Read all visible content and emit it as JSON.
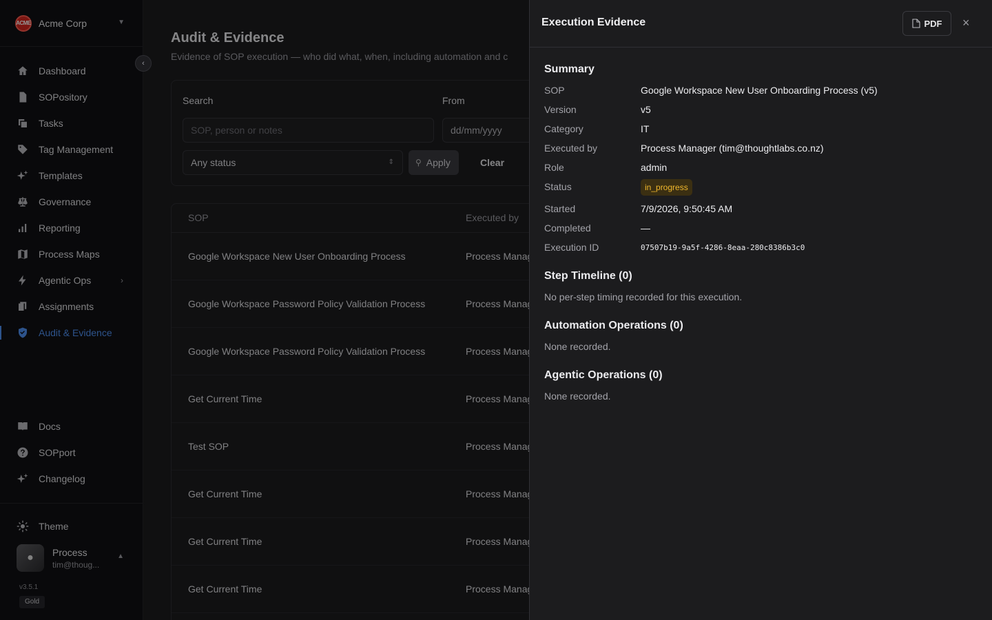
{
  "sidebar": {
    "org": {
      "logo_text": "ACME",
      "name": "Acme Corp"
    },
    "items": [
      {
        "label": "Dashboard",
        "icon": "home-icon"
      },
      {
        "label": "SOPository",
        "icon": "document-icon"
      },
      {
        "label": "Tasks",
        "icon": "copy-icon"
      },
      {
        "label": "Tag Management",
        "icon": "tag-icon"
      },
      {
        "label": "Templates",
        "icon": "sparkles-icon"
      },
      {
        "label": "Governance",
        "icon": "scale-icon"
      },
      {
        "label": "Reporting",
        "icon": "bar-chart-icon"
      },
      {
        "label": "Process Maps",
        "icon": "map-icon"
      },
      {
        "label": "Agentic Ops",
        "icon": "bolt-icon"
      },
      {
        "label": "Assignments",
        "icon": "assignment-icon"
      },
      {
        "label": "Audit & Evidence",
        "icon": "shield-check-icon",
        "active": true
      }
    ],
    "bottom_items": [
      {
        "label": "Docs",
        "icon": "book-icon"
      },
      {
        "label": "SOPport",
        "icon": "help-icon"
      },
      {
        "label": "Changelog",
        "icon": "sparkles-icon"
      }
    ],
    "theme_label": "Theme",
    "user": {
      "name": "Process",
      "email": "tim@thoug..."
    },
    "version": "v3.5.1",
    "tier": "Gold"
  },
  "main": {
    "title": "Audit & Evidence",
    "subtitle": "Evidence of SOP execution — who did what, when, including automation and c",
    "filters": {
      "search_label": "Search",
      "search_placeholder": "SOP, person or notes",
      "from_label": "From",
      "from_placeholder": "dd/mm/yyyy",
      "status_value": "Any status",
      "apply_label": "Apply",
      "clear_label": "Clear"
    },
    "table": {
      "columns": [
        "SOP",
        "Executed by"
      ],
      "rows": [
        {
          "sop": "Google Workspace New User Onboarding Process",
          "by": "Process Manager"
        },
        {
          "sop": "Google Workspace Password Policy Validation Process",
          "by": "Process Manager"
        },
        {
          "sop": "Google Workspace Password Policy Validation Process",
          "by": "Process Manager"
        },
        {
          "sop": "Get Current Time",
          "by": "Process Manager"
        },
        {
          "sop": "Test SOP",
          "by": "Process Manager"
        },
        {
          "sop": "Get Current Time",
          "by": "Process Manager"
        },
        {
          "sop": "Get Current Time",
          "by": "Process Manager"
        },
        {
          "sop": "Get Current Time",
          "by": "Process Manager"
        }
      ]
    }
  },
  "drawer": {
    "title": "Execution Evidence",
    "pdf_label": "PDF",
    "close_glyph": "×",
    "summary_title": "Summary",
    "summary": {
      "sop_label": "SOP",
      "sop_value": "Google Workspace New User Onboarding Process (v5)",
      "version_label": "Version",
      "version_value": "v5",
      "category_label": "Category",
      "category_value": "IT",
      "executed_by_label": "Executed by",
      "executed_by_value": "Process Manager (tim@thoughtlabs.co.nz)",
      "role_label": "Role",
      "role_value": "admin",
      "status_label": "Status",
      "status_value": "in_progress",
      "started_label": "Started",
      "started_value": "7/9/2026, 9:50:45 AM",
      "completed_label": "Completed",
      "completed_value": "—",
      "execution_id_label": "Execution ID",
      "execution_id_value": "07507b19-9a5f-4286-8eaa-280c8386b3c0"
    },
    "timeline_title": "Step Timeline (0)",
    "timeline_empty": "No per-step timing recorded for this execution.",
    "automation_title": "Automation Operations (0)",
    "automation_empty": "None recorded.",
    "agentic_title": "Agentic Operations (0)",
    "agentic_empty": "None recorded."
  },
  "colors": {
    "accent": "#4e8ff0",
    "status_in_progress_bg": "#3b2f12",
    "status_in_progress_text": "#f1b82d",
    "logo_red": "#d4261f"
  }
}
